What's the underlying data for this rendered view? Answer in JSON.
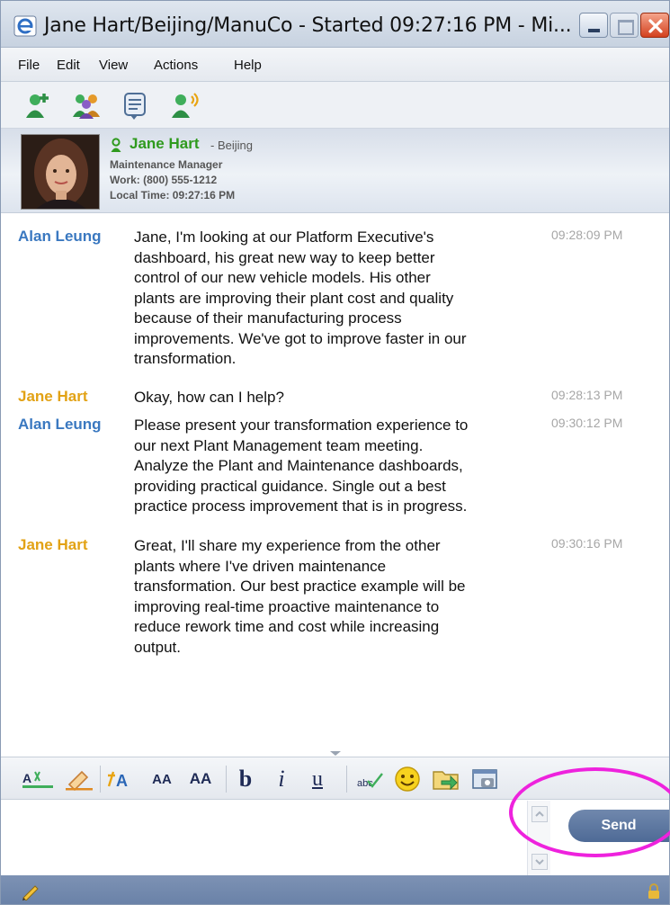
{
  "window": {
    "title": "Jane Hart/Beijing/ManuCo - Started 09:27:16 PM - Mi...",
    "title_icon": "browser-e-icon"
  },
  "menu": {
    "items": [
      "File",
      "Edit",
      "View",
      "Actions",
      "Help"
    ]
  },
  "toolbar": {
    "icons": [
      "add-contact-icon",
      "group-icon",
      "chat-history-icon",
      "voice-call-icon"
    ]
  },
  "contact": {
    "name": "Jane Hart",
    "location": "- Beijing",
    "title": "Maintenance Manager",
    "work_phone": "Work: (800) 555-1212",
    "local_time": "Local Time: 09:27:16 PM",
    "presence_color": "#2f9a1e"
  },
  "messages": [
    {
      "sender": "Alan Leung",
      "time": "09:28:09 PM",
      "lines": [
        "Jane, I'm looking at our Platform Executive's",
        "dashboard, his great new way to keep better",
        "control of our new vehicle models.  His other",
        "plants are improving their plant cost and quality",
        "because of their manufacturing process",
        "improvements.   We've got to improve faster in our",
        "transformation."
      ]
    },
    {
      "sender": "Jane Hart",
      "time": "09:28:13 PM",
      "lines": [
        "Okay, how can I help?"
      ]
    },
    {
      "sender": "Alan Leung",
      "time": "09:30:12 PM",
      "lines": [
        "Please present your transformation experience to",
        "our next Plant Management team meeting.",
        "Analyze the Plant and Maintenance dashboards,",
        "providing practical guidance.    Single out a best",
        "practice process improvement that is in progress."
      ]
    },
    {
      "sender": "Jane Hart",
      "time": "09:30:16 PM",
      "lines": [
        "Great, I'll share my experience from the other",
        "plants where I've driven maintenance",
        "transformation.   Our best practice example will be",
        "improving real-time proactive maintenance to",
        "reduce rework time and cost while increasing",
        "output."
      ]
    }
  ],
  "format_bar": {
    "text_color_label": "A",
    "font_label": "A",
    "shrink_label": "AA",
    "grow_label": "AA",
    "bold_label": "b",
    "italic_label": "i",
    "underline_label": "u",
    "spell_label": "abc"
  },
  "compose": {
    "value": "",
    "send_label": "Send"
  },
  "colors": {
    "alan_name": "#3a78c0",
    "jane_name": "#e2a215",
    "timestamp": "#a6a6a6",
    "highlight": "#ee22dd",
    "status_bar": "#6a82a8"
  }
}
